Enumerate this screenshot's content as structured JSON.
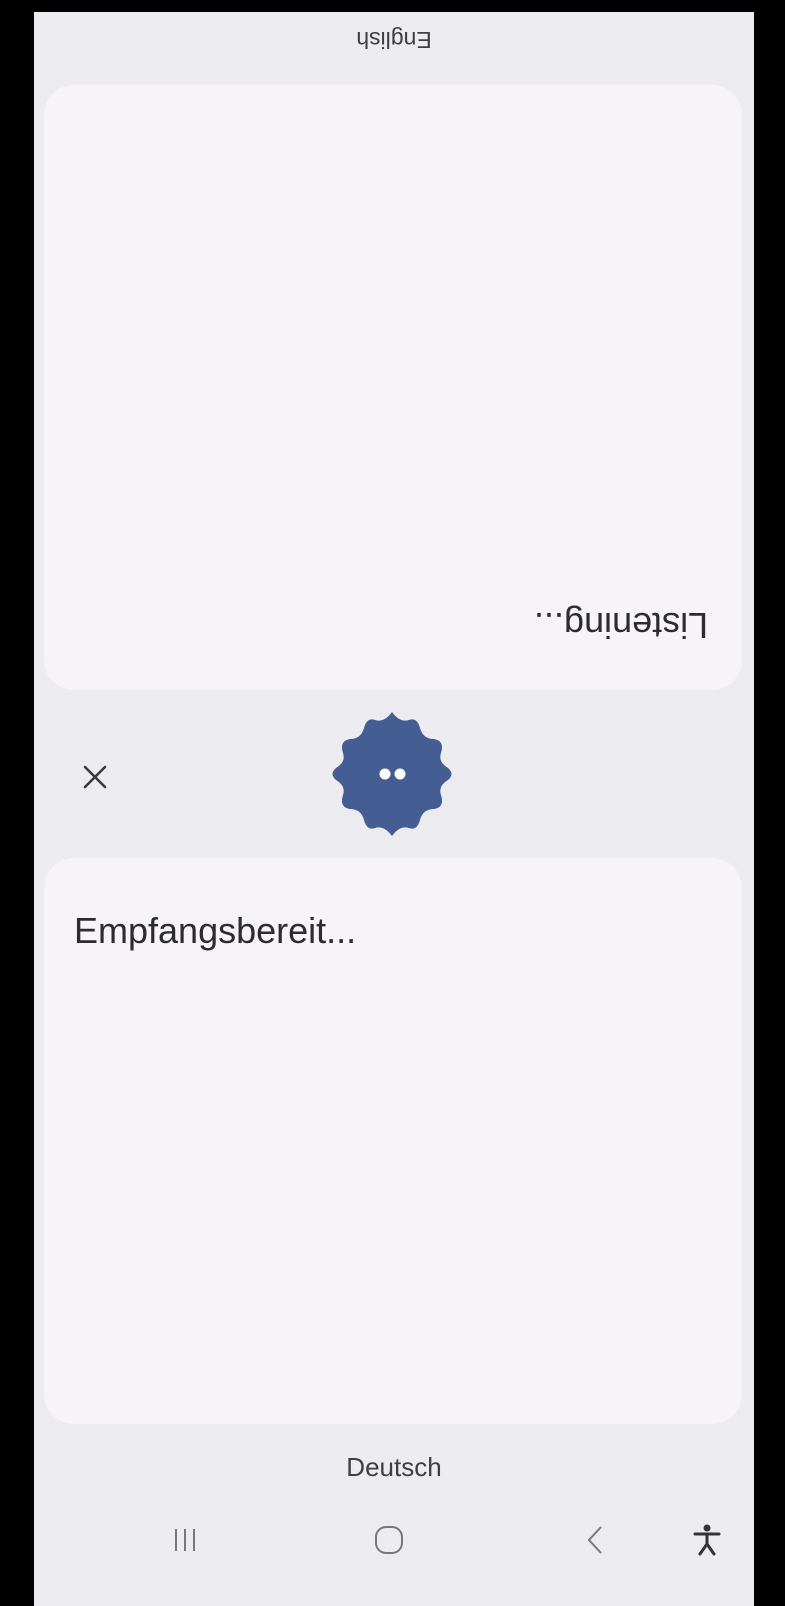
{
  "top_panel": {
    "language_label": "English",
    "status_text": "Listening..."
  },
  "bottom_panel": {
    "language_label": "Deutsch",
    "status_text": "Empfangsbereit..."
  },
  "controls": {
    "close_icon": "close-icon",
    "mic_icon": "listening-blob-icon"
  },
  "navbar": {
    "items": [
      "recent-apps-icon",
      "home-icon",
      "back-icon",
      "accessibility-icon"
    ]
  },
  "colors": {
    "background": "#ECEBF0",
    "card": "#F7F4F9",
    "accent": "#445D93"
  }
}
